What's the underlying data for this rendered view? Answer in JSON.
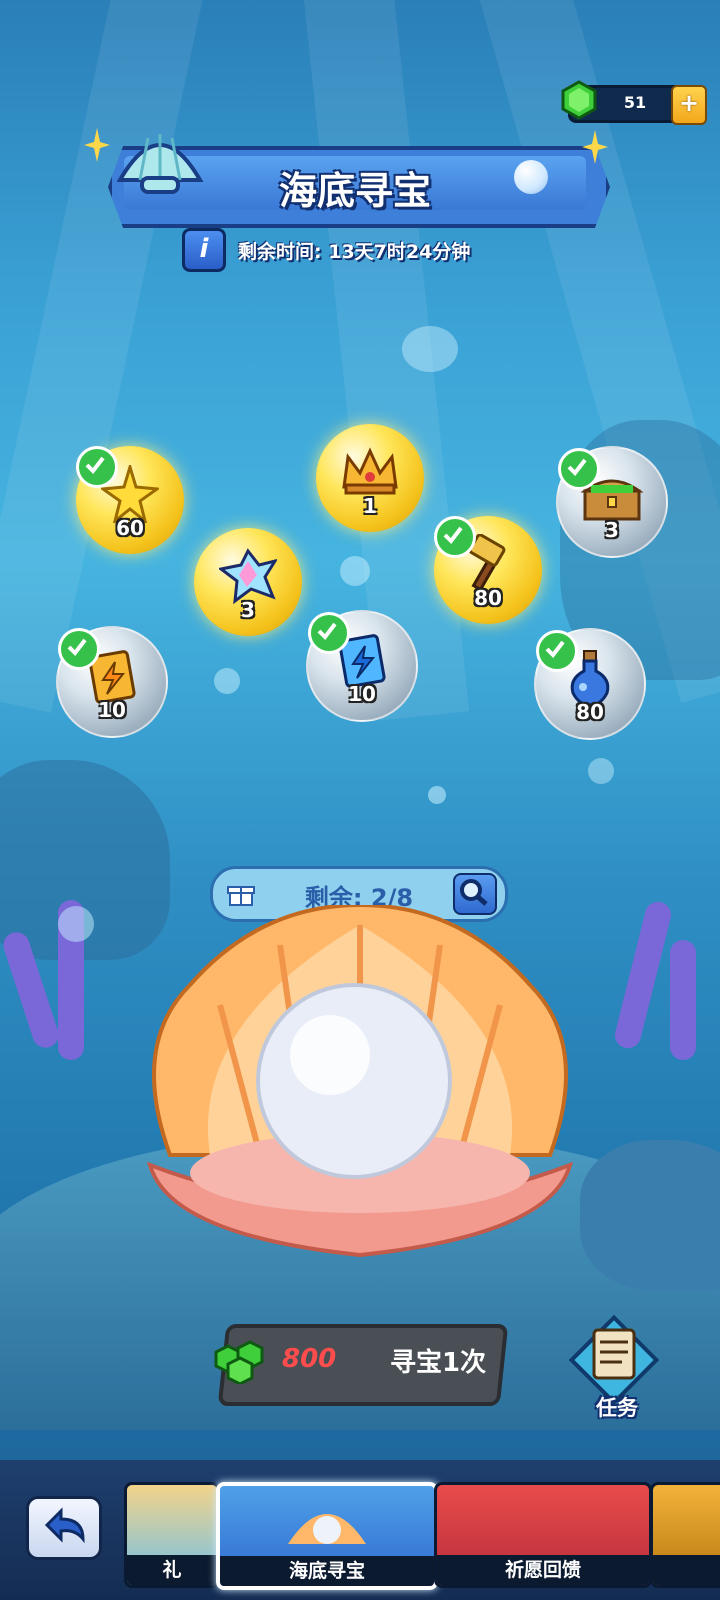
{
  "currency": {
    "gems": "51",
    "add": "+"
  },
  "event": {
    "title": "海底寻宝",
    "timer_label": "剩余时间:",
    "timer_value": "13天7时24分钟",
    "info": "i"
  },
  "rewards": [
    {
      "name": "gold-star",
      "count": "60",
      "claimed": true,
      "style": "gold"
    },
    {
      "name": "crown",
      "count": "1",
      "claimed": false,
      "style": "gold"
    },
    {
      "name": "treasure-chest",
      "count": "3",
      "claimed": true,
      "style": "silver"
    },
    {
      "name": "rainbow-crystal",
      "count": "3",
      "claimed": false,
      "style": "gold"
    },
    {
      "name": "hammer",
      "count": "80",
      "claimed": true,
      "style": "gold"
    },
    {
      "name": "yellow-energy-pack",
      "count": "10",
      "claimed": true,
      "style": "silver"
    },
    {
      "name": "blue-energy-pack",
      "count": "10",
      "claimed": true,
      "style": "silver"
    },
    {
      "name": "potion",
      "count": "80",
      "claimed": true,
      "style": "silver"
    }
  ],
  "remaining": {
    "label": "剩余:",
    "value": "2/8"
  },
  "action": {
    "cost": "800",
    "label": "寻宝1次"
  },
  "task": {
    "label": "任务"
  },
  "nav": {
    "tabs": [
      {
        "label": "礼",
        "active": false
      },
      {
        "label": "海底寻宝",
        "active": true
      },
      {
        "label": "祈愿回馈",
        "active": false
      },
      {
        "label": "",
        "active": false
      }
    ]
  },
  "colors": {
    "accent": "#3d7fd9",
    "gold": "#f4c21b",
    "check": "#36c24a",
    "cost": "#ff4d4d"
  }
}
